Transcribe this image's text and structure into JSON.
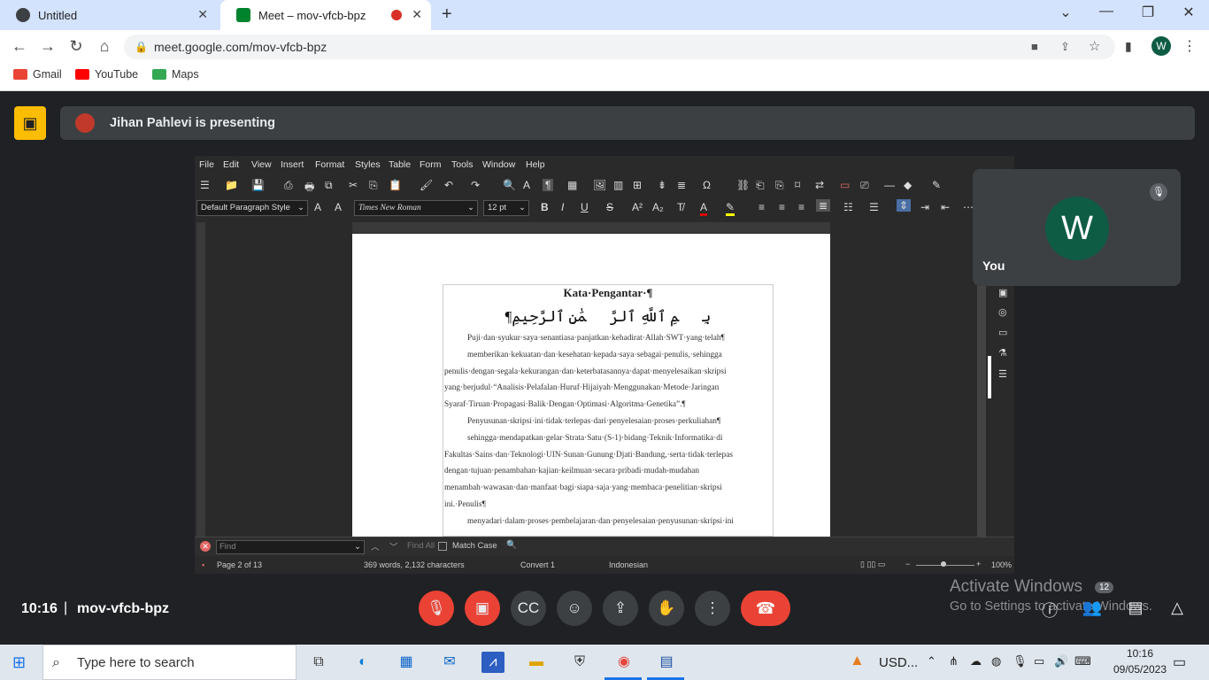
{
  "browser": {
    "tabs": [
      {
        "title": "Untitled"
      },
      {
        "title": "Meet – mov-vfcb-bpz"
      }
    ],
    "url": "meet.google.com/mov-vfcb-bpz",
    "profile_initial": "W",
    "bookmarks": [
      {
        "label": "Gmail",
        "color": "#ea4335"
      },
      {
        "label": "YouTube",
        "color": "#ff0000"
      },
      {
        "label": "Maps",
        "color": "#34a853"
      }
    ]
  },
  "meet": {
    "presenting_text": "Jihan Pahlevi is presenting",
    "self_label": "You",
    "self_initial": "W",
    "time": "10:16",
    "separator": "|",
    "meeting_code": "mov-vfcb-bpz",
    "participants_count": "12",
    "controls": [
      "mic-off-icon",
      "camera-off-icon",
      "captions-icon",
      "emoji-icon",
      "present-icon",
      "raise-hand-icon",
      "more-options-icon",
      "end-call-icon"
    ]
  },
  "writer": {
    "menus": [
      "File",
      "Edit",
      "View",
      "Insert",
      "Format",
      "Styles",
      "Table",
      "Form",
      "Tools",
      "Window",
      "Help"
    ],
    "paragraph_style": "Default Paragraph Style",
    "font_name": "Times New Roman",
    "font_size": "12 pt",
    "doc_title": "Kata·Pengantar·¶",
    "arabic_line": "¶بِسۡمِ ٱللَّهِ ٱلرَّحۡمَٰنِ ٱلرَّحِيمِ",
    "paragraphs": [
      "Puji·dan·syukur·saya·senantiasa·panjatkan·kehadirat·Allah·SWT·yang·telah¶",
      "memberikan·kekuatan·dan·kesehatan·kepada·saya·sebagai·penulis,·sehingga",
      "penulis·dengan·segala·kekurangan·dan·keterbatasannya·dapat·menyelesaikan·skripsi",
      "yang·berjudul·“Analisis·Pelafalan·Huruf·Hijaiyah·Menggunakan·Metode·Jaringan",
      "Syaraf·Tiruan·Propagasi·Balik·Dengan·Optimasi·Algoritma·Genetika”.¶",
      "Penyusunan·skripsi·ini·tidak·terlepas·dari·penyelesaian·proses·perkuliahan¶",
      "sehingga·mendapatkan·gelar·Strata·Satu·(S-1)·bidang·Teknik·Informatika·di",
      "Fakultas·Sains·dan·Teknologi·UIN·Sunan·Gunung·Djati·Bandung,·serta·tidak·terlepas",
      "dengan·tujuan·penambahan·kajian·keilmuan·secara·pribadi·mudah-mudahan",
      "menambah·wawasan·dan·manfaat·bagi·siapa·saja·yang·membaca·penelitian·skripsi",
      "ini.·Penulis¶",
      "menyadari·dalam·proses·pembelajaran·dan·penyelesaian·penyusunan·skripsi·ini"
    ],
    "find_placeholder": "Find",
    "find_all": "Find All",
    "match_case": "Match Case",
    "status_page": "Page 2 of 13",
    "status_words": "369 words, 2,132 characters",
    "status_convert": "Convert 1",
    "status_lang": "Indonesian",
    "status_zoom": "100%"
  },
  "watermark": {
    "line1": "Activate Windows",
    "line2": "Go to Settings to activate Windows."
  },
  "taskbar": {
    "search_placeholder": "Type here to search",
    "currency": "USD...",
    "time": "10:16",
    "date": "09/05/2023"
  }
}
